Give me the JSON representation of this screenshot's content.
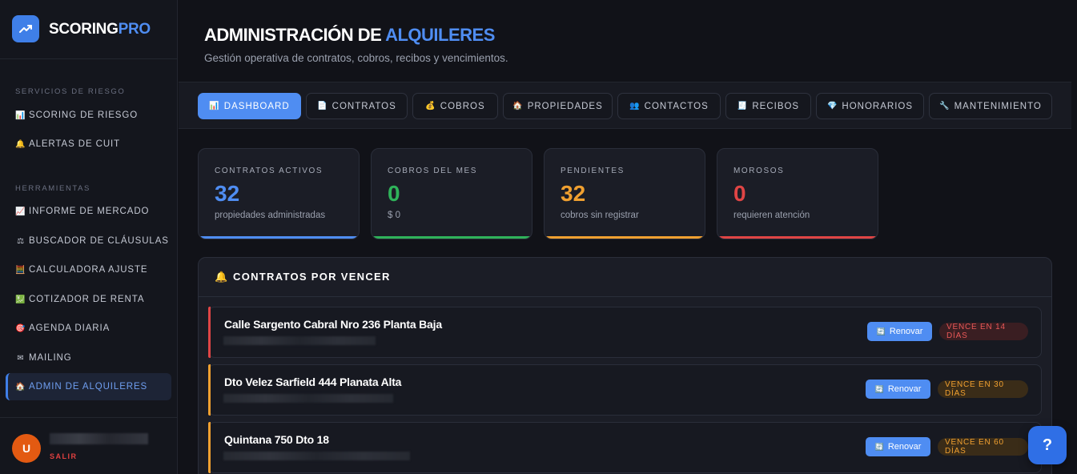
{
  "brand": {
    "name_a": "SCORING",
    "name_b": "PRO"
  },
  "sidebar": {
    "section_risk": "SERVICIOS DE RIESGO",
    "section_tools": "HERRAMIENTAS",
    "items": [
      {
        "icon": "📊",
        "label": "SCORING DE RIESGO"
      },
      {
        "icon": "🔔",
        "label": "ALERTAS DE CUIT"
      },
      {
        "icon": "📈",
        "label": "INFORME DE MERCADO"
      },
      {
        "icon": "⚖",
        "label": "BUSCADOR DE CLÁUSULAS"
      },
      {
        "icon": "🧮",
        "label": "CALCULADORA AJUSTE"
      },
      {
        "icon": "💹",
        "label": "COTIZADOR DE RENTA"
      },
      {
        "icon": "🎯",
        "label": "AGENDA DIARIA"
      },
      {
        "icon": "✉",
        "label": "MAILING"
      },
      {
        "icon": "🏠",
        "label": "ADMIN DE ALQUILERES"
      }
    ],
    "user": {
      "initial": "U",
      "logout": "SALIR"
    }
  },
  "header": {
    "title_a": "ADMINISTRACIÓN DE",
    "title_b": "ALQUILERES",
    "subtitle": "Gestión operativa de contratos, cobros, recibos y vencimientos."
  },
  "tabs": [
    {
      "icon": "📊",
      "label": "DASHBOARD"
    },
    {
      "icon": "📄",
      "label": "CONTRATOS"
    },
    {
      "icon": "💰",
      "label": "COBROS"
    },
    {
      "icon": "🏠",
      "label": "PROPIEDADES"
    },
    {
      "icon": "👥",
      "label": "CONTACTOS"
    },
    {
      "icon": "🧾",
      "label": "RECIBOS"
    },
    {
      "icon": "💎",
      "label": "HONORARIOS"
    },
    {
      "icon": "🔧",
      "label": "MANTENIMIENTO"
    }
  ],
  "stats": [
    {
      "label": "CONTRATOS ACTIVOS",
      "value": "32",
      "sub": "propiedades administradas",
      "color": "#4f8df2"
    },
    {
      "label": "COBROS DEL MES",
      "value": "0",
      "sub": "$ 0",
      "color": "#2fb35a"
    },
    {
      "label": "PENDIENTES",
      "value": "32",
      "sub": "cobros sin registrar",
      "color": "#f0a030"
    },
    {
      "label": "MOROSOS",
      "value": "0",
      "sub": "requieren atención",
      "color": "#e04545"
    }
  ],
  "expiring": {
    "title": "CONTRATOS POR VENCER",
    "renew_label": "Renovar",
    "rows": [
      {
        "address": "Calle Sargento Cabral Nro 236 Planta Baja",
        "badge": "VENCE EN 14 DÍAS",
        "accent": "#e04545"
      },
      {
        "address": "Dto Velez Sarfield 444 Planata Alta",
        "badge": "VENCE EN 30 DÍAS",
        "accent": "#f0a030"
      },
      {
        "address": "Quintana 750 Dto 18",
        "badge": "VENCE EN 60 DÍAS",
        "accent": "#f0a030"
      }
    ]
  },
  "help": {
    "label": "?"
  }
}
